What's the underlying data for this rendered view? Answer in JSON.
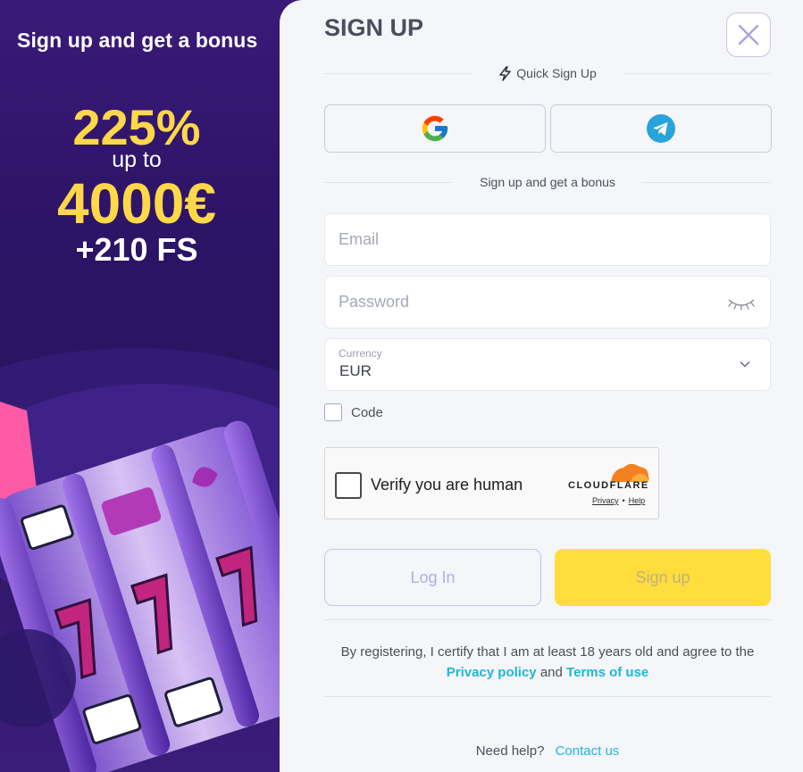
{
  "promo": {
    "title": "Sign up and get a bonus",
    "percent": "225%",
    "upto": "up to",
    "amount": "4000€",
    "free_spins": "+210 FS"
  },
  "form": {
    "title": "SIGN UP",
    "quick_signup": "Quick Sign Up",
    "bonus_divider": "Sign up and get a bonus",
    "email_placeholder": "Email",
    "password_placeholder": "Password",
    "currency_label": "Currency",
    "currency_value": "EUR",
    "code_label": "Code",
    "login_button": "Log In",
    "signup_button": "Sign up"
  },
  "captcha": {
    "label": "Verify you are human",
    "brand": "CLOUDFLARE",
    "privacy": "Privacy",
    "separator": "•",
    "help": "Help"
  },
  "legal": {
    "text": "By registering, I certify that I am at least 18 years old and agree to the",
    "privacy_link": "Privacy policy",
    "and": "and",
    "terms_link": "Terms of use"
  },
  "footer": {
    "need_help": "Need help?",
    "contact_link": "Contact us"
  },
  "icons": {
    "close": "close-icon",
    "bolt": "lightning-icon",
    "google": "google-icon",
    "telegram": "telegram-icon",
    "eye": "eye-closed-icon",
    "chevron": "chevron-down-icon"
  },
  "colors": {
    "accent_yellow": "#ffd84a",
    "signup_button": "#ffdd3d",
    "link": "#1db7d7",
    "promo_bg": "#2c1466",
    "panel_bg": "#f5f6fa"
  }
}
